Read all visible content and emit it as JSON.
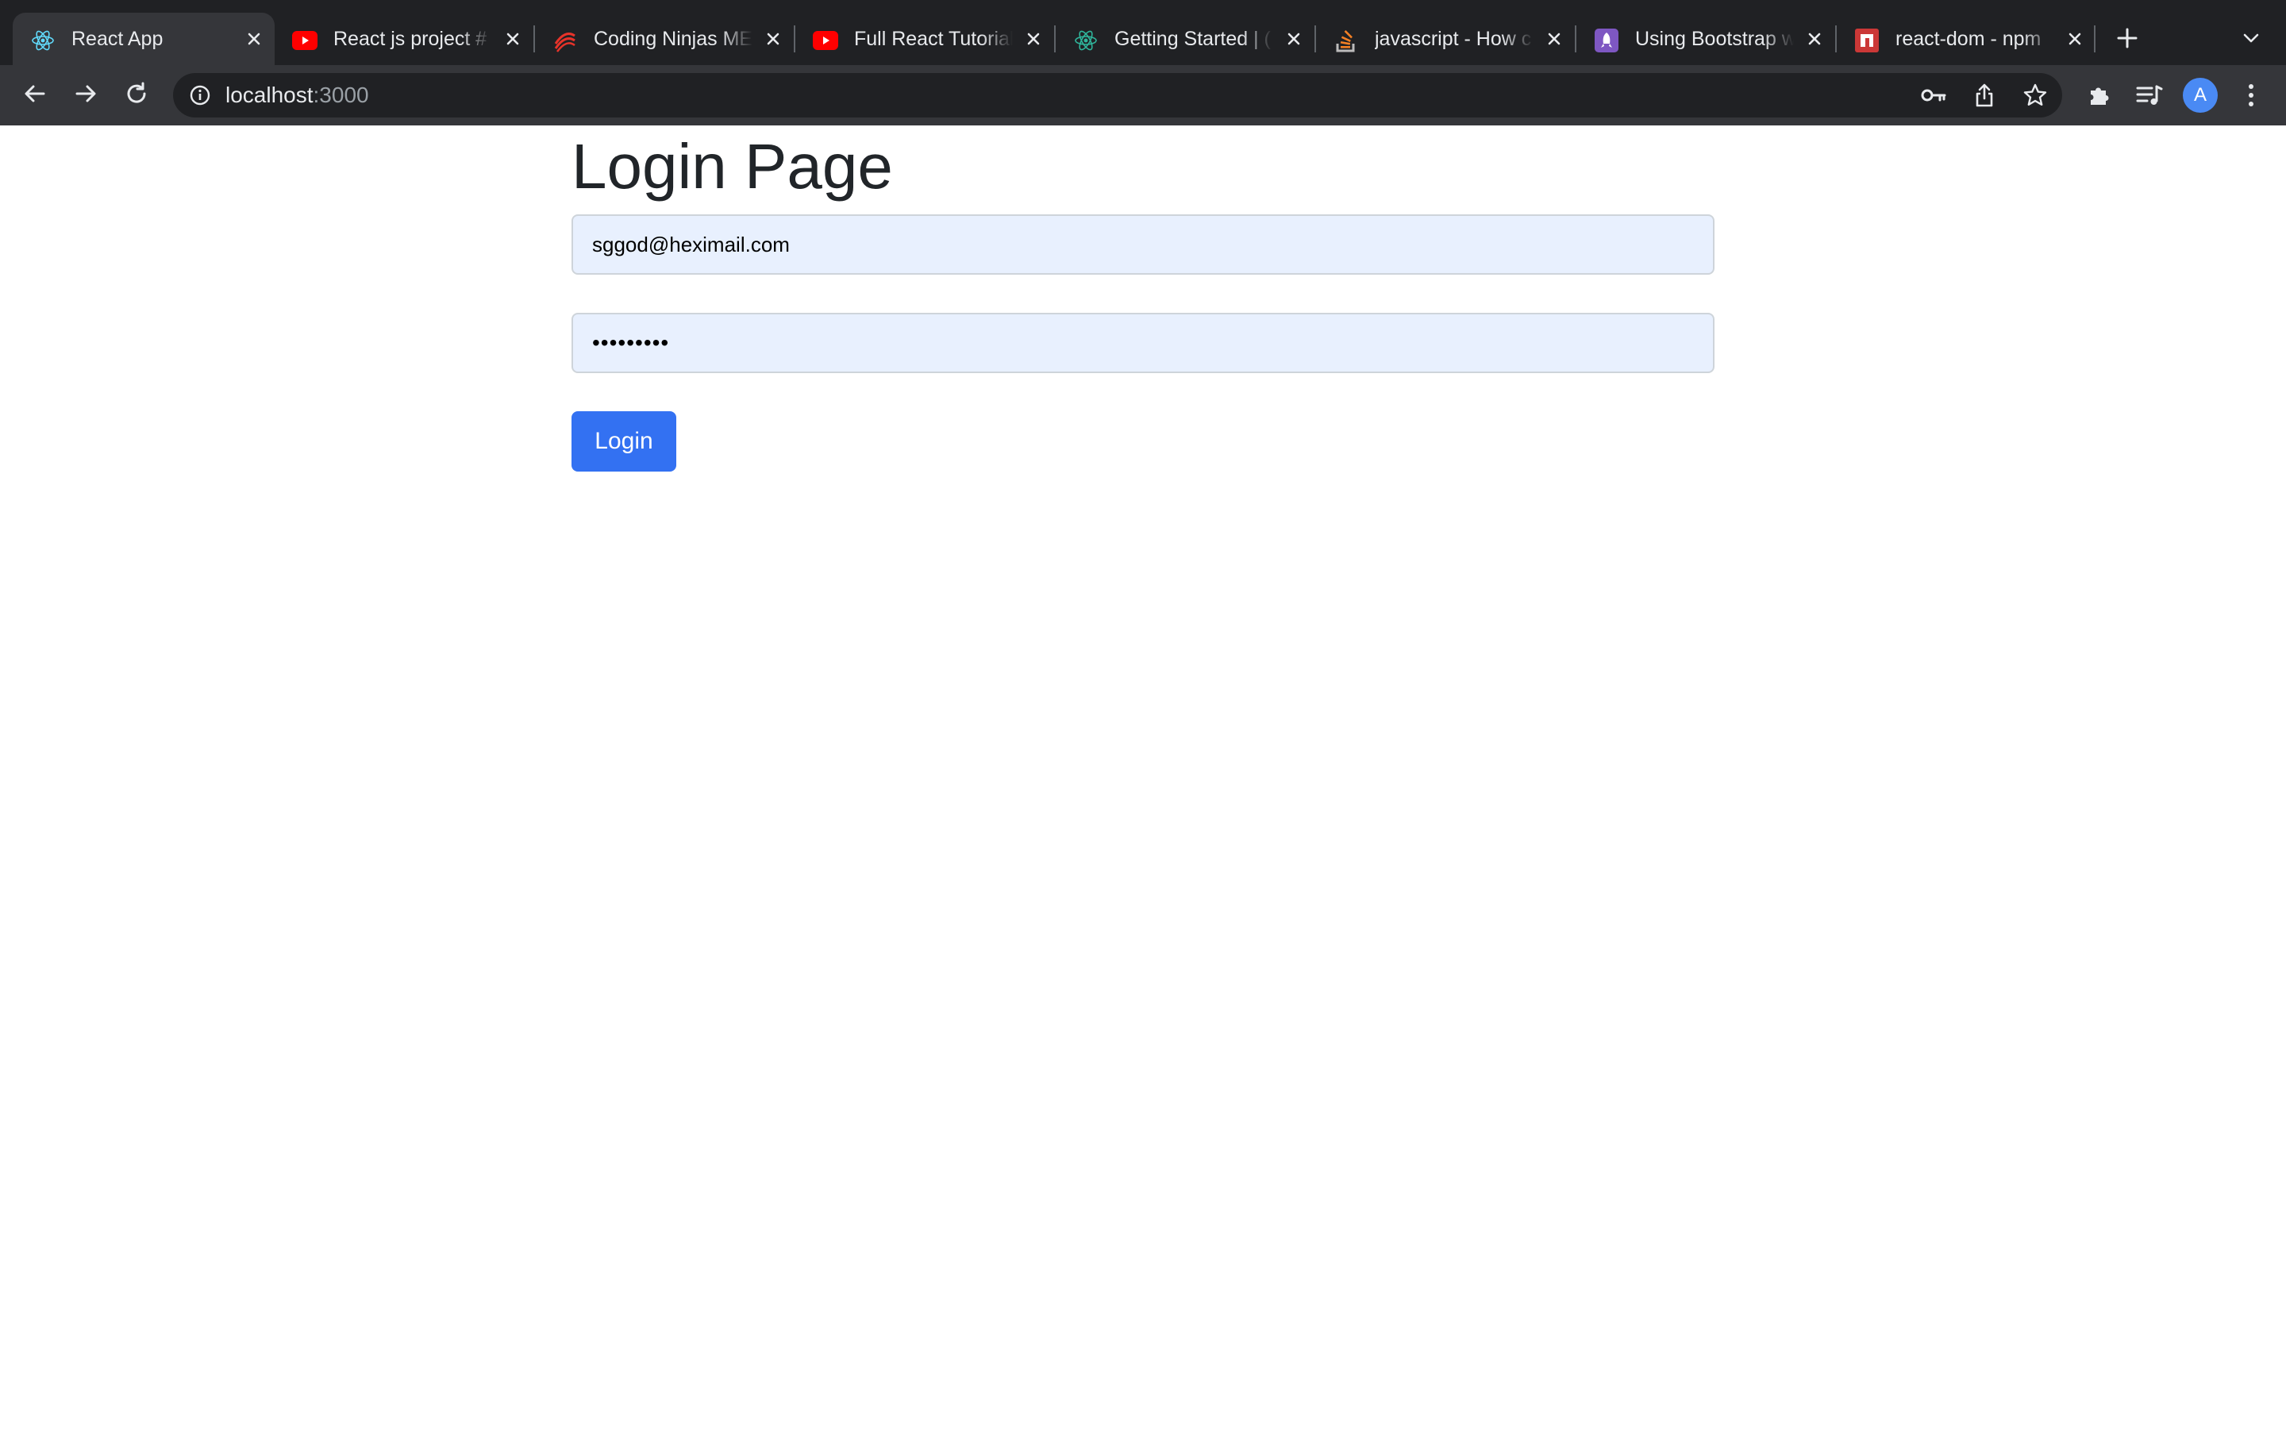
{
  "browser": {
    "tabs": [
      {
        "title": "React App",
        "icon": "react-icon",
        "active": true
      },
      {
        "title": "React js project #",
        "icon": "youtube-icon",
        "active": false
      },
      {
        "title": "Coding Ninjas ME",
        "icon": "coding-ninjas-icon",
        "active": false
      },
      {
        "title": "Full React Tutorial",
        "icon": "youtube-icon",
        "active": false
      },
      {
        "title": "Getting Started | (",
        "icon": "react-icon",
        "active": false
      },
      {
        "title": "javascript - How c",
        "icon": "stackoverflow-icon",
        "active": false
      },
      {
        "title": "Using Bootstrap w",
        "icon": "bootstrap-icon",
        "active": false
      },
      {
        "title": "react-dom - npm",
        "icon": "npm-icon",
        "active": false
      }
    ],
    "address": {
      "host": "localhost",
      "port": ":3000"
    },
    "profile_initial": "A",
    "colors": {
      "tabstrip": "#202124",
      "toolbar": "#35363a",
      "omnibox": "#202124"
    }
  },
  "page": {
    "title": "Login Page",
    "email_value": "sggod@heximail.com",
    "password_value": "•••••••••",
    "login_label": "Login",
    "colors": {
      "primary": "#3371f2",
      "autofill_bg": "#e8f0fe",
      "input_border": "#ced4da",
      "heading": "#212529"
    }
  }
}
